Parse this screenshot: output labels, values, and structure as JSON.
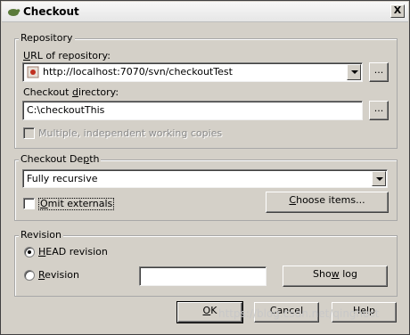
{
  "window": {
    "title": "Checkout",
    "close_label": "X"
  },
  "repository": {
    "legend": "Repository",
    "url_label_pre": "",
    "url_label_ul": "U",
    "url_label_post": "RL of repository:",
    "url_value": "http://localhost:7070/svn/checkoutTest",
    "browse_label": "...",
    "dir_label_pre": "Checkout ",
    "dir_label_ul": "d",
    "dir_label_post": "irectory:",
    "dir_value": "C:\\checkoutThis",
    "browse_dir_label": "...",
    "multi_label": "Multiple, independent working copies"
  },
  "depth": {
    "legend_pre": "Checkout De",
    "legend_ul": "p",
    "legend_post": "th",
    "selected": "Fully recursive",
    "omit_pre": "",
    "omit_ul": "O",
    "omit_post": "mit externals",
    "choose_pre": "",
    "choose_ul": "C",
    "choose_post": "hoose items..."
  },
  "revision": {
    "legend": "Revision",
    "head_pre": "",
    "head_ul": "H",
    "head_post": "EAD revision",
    "rev_pre": "",
    "rev_ul": "R",
    "rev_post": "evision",
    "rev_value": "",
    "show_log_pre": "Sho",
    "show_log_ul": "w",
    "show_log_post": " log"
  },
  "buttons": {
    "ok_ul": "O",
    "ok_post": "K",
    "cancel": "Cancel",
    "help": "Help"
  },
  "watermark": "https://blog.csdn.net/qinghost",
  "colors": {
    "dialog_bg": "#d4d0c8",
    "field_bg": "#ffffff"
  }
}
